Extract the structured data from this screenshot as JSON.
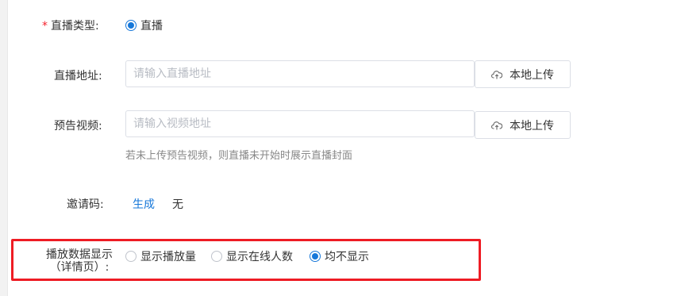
{
  "live_type": {
    "required_mark": "*",
    "label": "直播类型:",
    "option": "直播"
  },
  "live_url": {
    "label": "直播地址:",
    "placeholder": "请输入直播地址",
    "value": "",
    "upload_label": "本地上传"
  },
  "preview_video": {
    "label": "预告视频:",
    "placeholder": "请输入视频地址",
    "value": "",
    "upload_label": "本地上传",
    "hint": "若未上传预告视频，则直播未开始时展示直播封面"
  },
  "invite_code": {
    "label": "邀请码:",
    "generate_label": "生成",
    "value": "无"
  },
  "playback_display": {
    "label_line1": "播放数据显示",
    "label_line2": "（详情页）:",
    "options": [
      "显示播放量",
      "显示在线人数",
      "均不显示"
    ],
    "selected": "均不显示"
  },
  "icons": {
    "upload": "cloud-upload-icon"
  },
  "colors": {
    "accent": "#1677d9",
    "required": "#f5222d",
    "highlight": "#ee1c24"
  }
}
